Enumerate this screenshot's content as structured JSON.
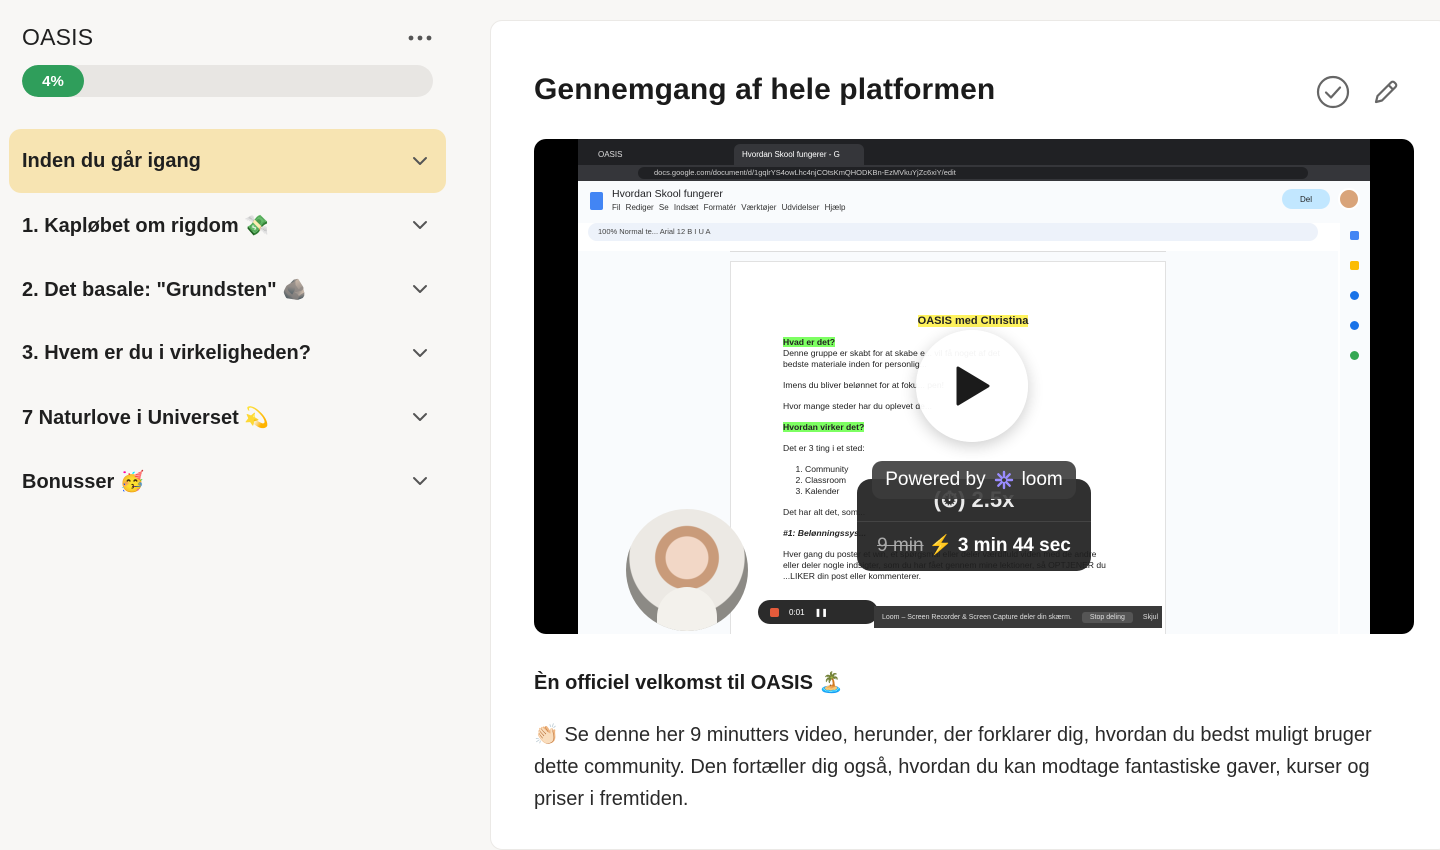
{
  "sidebar": {
    "course_title": "OASIS",
    "progress_value": 4,
    "progress_label": "4%",
    "modules": [
      {
        "label": "Inden du går igang",
        "active": true
      },
      {
        "label": "1. Kapløbet om rigdom 💸",
        "active": false
      },
      {
        "label": "2. Det basale: \"Grundsten\" 🪨",
        "active": false
      },
      {
        "label": "3. Hvem er du i virkeligheden?",
        "active": false
      },
      {
        "label": "7 Naturlove i Universet 💫",
        "active": false
      },
      {
        "label": "Bonusser 🥳",
        "active": false
      }
    ]
  },
  "lesson": {
    "title": "Gennemgang af hele platformen",
    "welcome_heading": "Èn officiel velkomst til OASIS 🏝️",
    "description": "👏🏻 Se denne her 9 minutters video, herunder, der forklarer dig, hvordan du bedst muligt bruger dette community. Den fortæller dig også, hvordan du kan modtage fantastiske gaver, kurser og priser i fremtiden."
  },
  "video": {
    "browser": {
      "tab1": "OASIS",
      "tab2": "Hvordan Skool fungerer - G",
      "url": "docs.google.com/document/d/1gqlrYS4owLhc4njCOtsKmQHODKBn-EzMVkuYjZc6xiY/edit"
    },
    "doc": {
      "name": "Hvordan Skool fungerer",
      "menu": "Fil Rediger Se Indsæt Formatér Værktøjer Udvidelser Hjælp",
      "share": "Del",
      "toolbar": "100%   Normal te...   Arial   12   B  I  U  A",
      "heading": "OASIS med Christina",
      "q1": "Hvad er det?",
      "line1": "Denne gruppe er skabt for at skabe e... vil få noget af det",
      "line2": "bedste materiale inden for personlig...",
      "line3": "Imens du bliver belønnet for at foku... pen!",
      "line4": "Hvor mange steder har du oplevet de...",
      "q2": "Hvordan virker det?",
      "line5": "Det er 3 ting i et sted:",
      "list": [
        "Community",
        "Classroom",
        "Kalender"
      ],
      "line6": "Det har alt det, som...",
      "line7": "#1: Belønningssys...",
      "line8": "Hver gang du poster et win, et spørgsmål eller deler værdifuld viden med de andre",
      "line9": "eller deler nogle indsigter, som du har fået gennem mine lektioner, så OPTJENER du",
      "line10": "...LIKER din post eller kommenterer."
    },
    "powered_by": "Powered by",
    "loom": "loom",
    "speed_label": "(⏱) 2.5x",
    "original_duration": "9 min",
    "fast_duration": "3 min 44 sec",
    "rec_time": "0:01",
    "rec_banner": "Loom – Screen Recorder & Screen Capture deler din skærm.",
    "rec_stop": "Stop deling",
    "rec_hide": "Skjul"
  },
  "colors": {
    "progress": "#2f9e5b",
    "active_module": "#f7e4b2"
  }
}
